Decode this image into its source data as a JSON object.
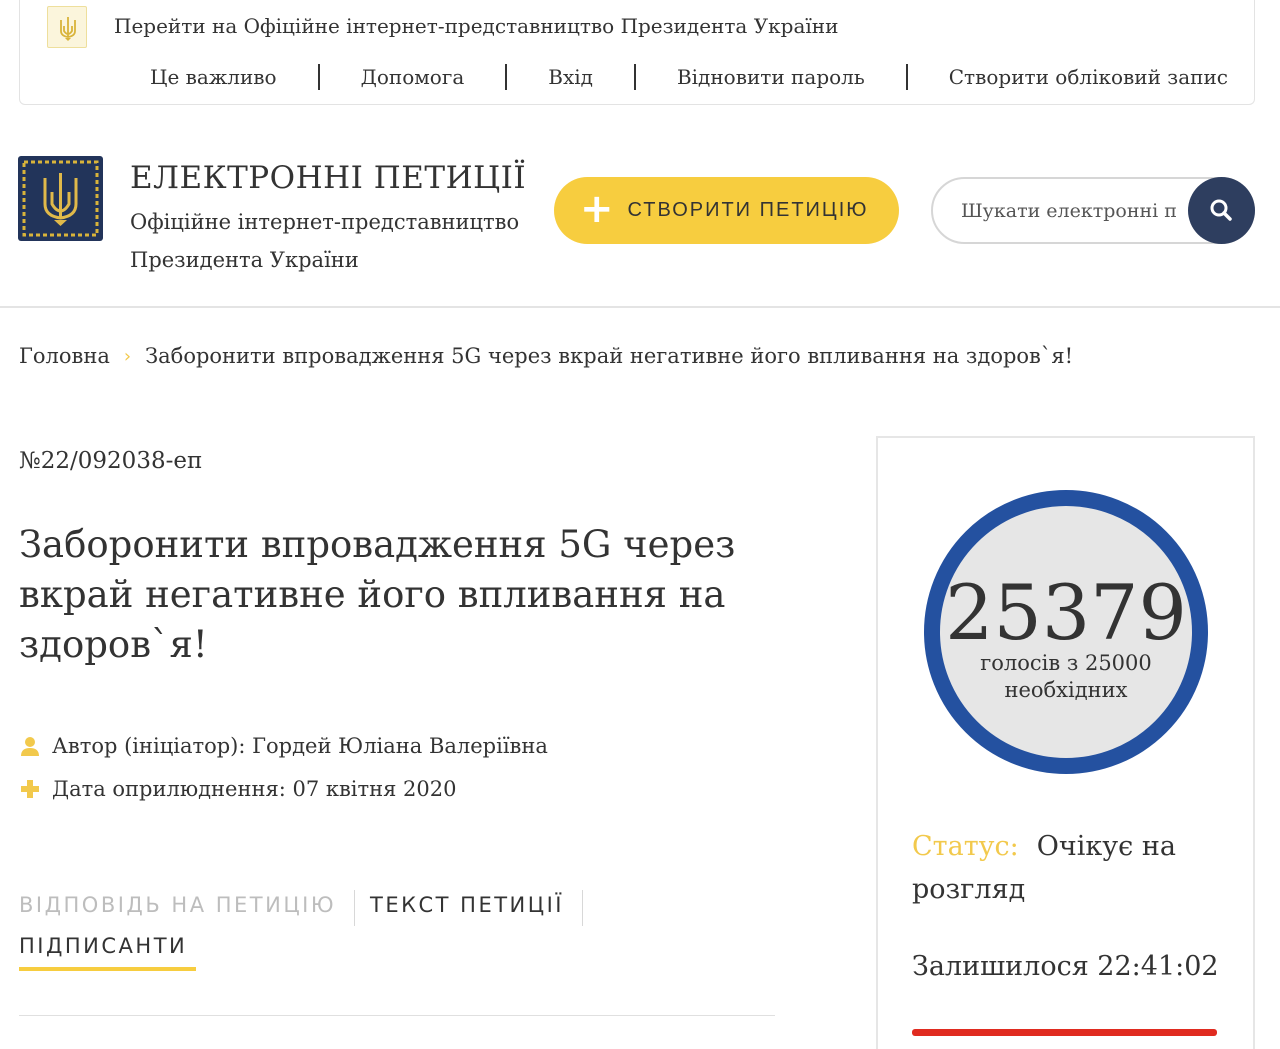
{
  "top_bar": {
    "official_link": "Перейти на Офіційне інтернет-представництво Президента України",
    "nav": [
      {
        "label": "Це важливо"
      },
      {
        "label": "Допомога"
      },
      {
        "label": "Вхід"
      },
      {
        "label": "Відновити пароль"
      },
      {
        "label": "Створити обліковий запис"
      }
    ]
  },
  "header": {
    "title": "ЕЛЕКТРОННІ ПЕТИЦІЇ",
    "subtitle": "Офіційне інтернет-представництво Президента України",
    "create_button": "СТВОРИТИ ПЕТИЦІЮ",
    "search_placeholder": "Шукати електронні петиції"
  },
  "breadcrumb": {
    "home": "Головна",
    "current": "Заборонити впровадження 5G через вкрай негативне його впливання на здоров`я!"
  },
  "petition": {
    "number": "№22/092038-еп",
    "title": "Заборонити впровадження 5G через вкрай негативне його впливання на здоров`я!",
    "author": "Автор (ініціатор): Гордей Юліана Валеріївна",
    "date": "Дата оприлюднення: 07 квітня 2020",
    "tabs": {
      "answer": "ВІДПОВІДЬ НА ПЕТИЦІЮ",
      "text": "ТЕКСТ ПЕТИЦІЇ",
      "signers": "ПІДПИСАНТИ"
    }
  },
  "sidebar": {
    "votes": 25379,
    "votes_text": "25379",
    "votes_label": "голосів з 25000 необхідних",
    "votes_required": 25000,
    "status_key": "Статус:",
    "status_value": "Очікує на розгляд",
    "remaining": "Залишилося 22:41:02",
    "progress_fraction": 1.0
  },
  "colors": {
    "accent_yellow": "#f7cd3f",
    "navy": "#2e3e5f",
    "circle_blue": "#2451a0",
    "progress_red": "#e02b20"
  }
}
